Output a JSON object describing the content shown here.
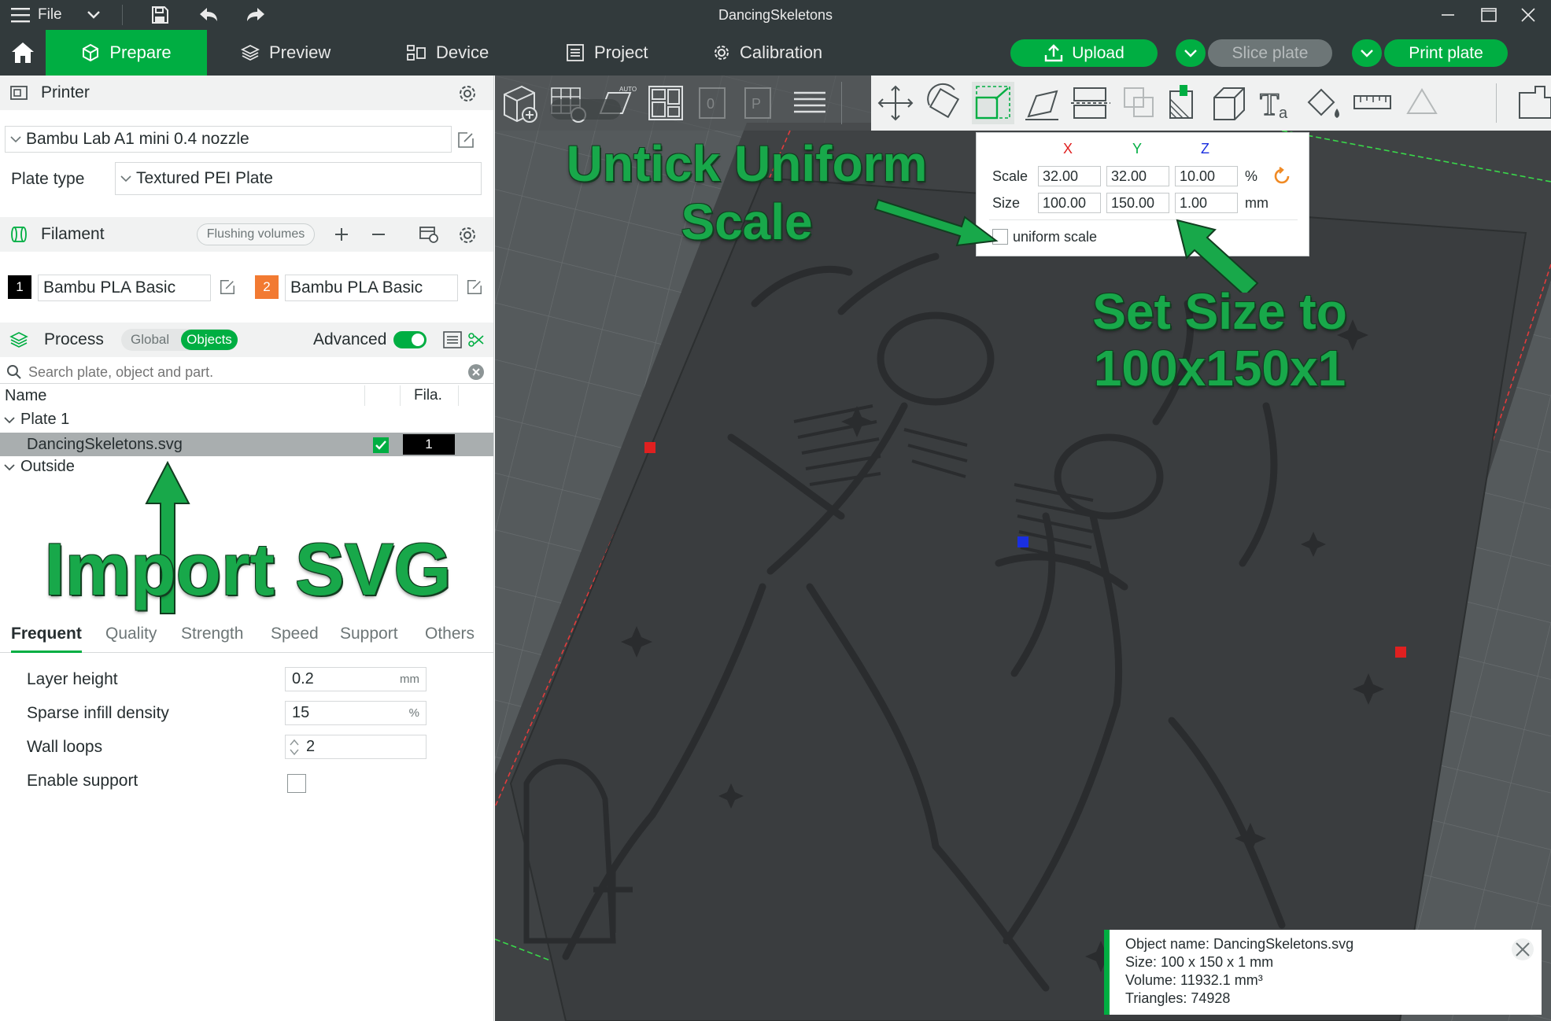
{
  "titlebar": {
    "menu_label": "File",
    "app_title": "DancingSkeletons"
  },
  "nav": {
    "tabs": [
      {
        "label": "Prepare",
        "icon": "cube-icon",
        "active": true
      },
      {
        "label": "Preview",
        "icon": "layers-icon",
        "active": false
      },
      {
        "label": "Device",
        "icon": "device-icon",
        "active": false
      },
      {
        "label": "Project",
        "icon": "list-icon",
        "active": false
      },
      {
        "label": "Calibration",
        "icon": "gear-icon",
        "active": false
      }
    ],
    "upload_label": "Upload",
    "slice_label": "Slice plate",
    "print_label": "Print plate"
  },
  "printer": {
    "section_title": "Printer",
    "printer_name": "Bambu Lab A1 mini 0.4 nozzle",
    "plate_type_label": "Plate type",
    "plate_type_value": "Textured PEI Plate"
  },
  "filament": {
    "section_title": "Filament",
    "flushing_label": "Flushing volumes",
    "items": [
      {
        "index": "1",
        "name": "Bambu PLA Basic",
        "color": "#000000"
      },
      {
        "index": "2",
        "name": "Bambu PLA Basic",
        "color": "#f27a32"
      }
    ]
  },
  "process": {
    "section_title": "Process",
    "global_label": "Global",
    "objects_label": "Objects",
    "advanced_label": "Advanced",
    "advanced_on": true,
    "search_placeholder": "Search plate, object and part."
  },
  "object_list": {
    "col_name": "Name",
    "col_fila": "Fila.",
    "plate_label": "Plate 1",
    "object_name": "DancingSkeletons.svg",
    "object_fila": "1",
    "outside_label": "Outside"
  },
  "param_tabs": [
    "Frequent",
    "Quality",
    "Strength",
    "Speed",
    "Support",
    "Others"
  ],
  "params": {
    "layer_height_label": "Layer height",
    "layer_height_value": "0.2",
    "layer_height_unit": "mm",
    "infill_label": "Sparse infill density",
    "infill_value": "15",
    "infill_unit": "%",
    "wall_loops_label": "Wall loops",
    "wall_loops_value": "2",
    "support_label": "Enable support",
    "support_checked": false
  },
  "scale_popup": {
    "axis_x": "X",
    "axis_y": "Y",
    "axis_z": "Z",
    "scale_label": "Scale",
    "size_label": "Size",
    "scale_x": "32.00",
    "scale_y": "32.00",
    "scale_z": "10.00",
    "scale_unit": "%",
    "size_x": "100.00",
    "size_y": "150.00",
    "size_z": "1.00",
    "size_unit": "mm",
    "uniform_label": "uniform scale",
    "uniform_checked": false
  },
  "annotations": {
    "untick_line1": "Untick Uniform",
    "untick_line2": "Scale",
    "setsize_line1": "Set Size to",
    "setsize_line2": "100x150x1",
    "import": "Import SVG"
  },
  "info": {
    "object_name": "Object name: DancingSkeletons.svg",
    "size": "Size: 100 x 150 x 1 mm",
    "volume": "Volume: 11932.1 mm³",
    "triangles": "Triangles: 74928"
  },
  "colors": {
    "accent": "#00ae42",
    "topbar": "#323a3c",
    "viewport": "#565b5d",
    "plate": "#3f4244",
    "annotation_green": "#18a84a"
  }
}
